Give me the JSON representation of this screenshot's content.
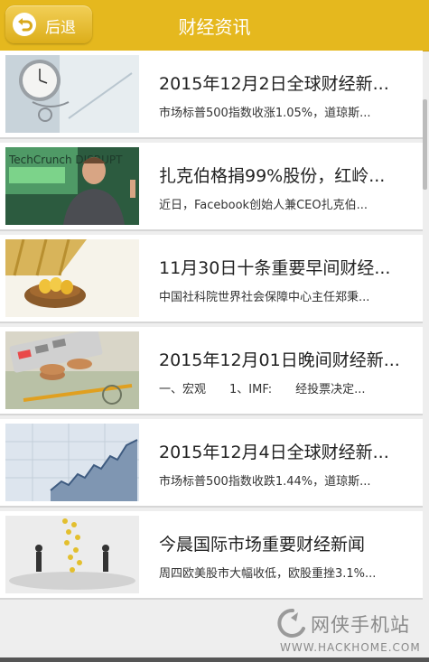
{
  "header": {
    "back_label": "后退",
    "title": "财经资讯",
    "accent_color": "#e5b81e"
  },
  "news": [
    {
      "title": "2015年12月2日全球财经新...",
      "summary": "市场标普500指数收涨1.05%，道琼斯...",
      "thumb": "pocket-watch"
    },
    {
      "title": "扎克伯格捐99%股份，红岭...",
      "summary": "近日，Facebook创始人兼CEO扎克伯...",
      "thumb": "speaker-on-stage",
      "thumb_text": "TechCrunch DISRUPT"
    },
    {
      "title": "11月30日十条重要早间财经...",
      "summary": "中国社科院世界社会保障中心主任郑秉...",
      "thumb": "nest-with-golden-eggs"
    },
    {
      "title": "2015年12月01日晚间财经新...",
      "summary": "一、宏观　　1、IMF:　　经投票决定...",
      "thumb": "coins-calculator-banknotes"
    },
    {
      "title": "2015年12月4日全球财经新...",
      "summary": "市场标普500指数收跌1.44%，道琼斯...",
      "thumb": "rising-stock-chart"
    },
    {
      "title": "今晨国际市场重要财经新闻",
      "summary": "周四欧美股市大幅收低，欧股重挫3.1%...",
      "thumb": "businessmen-and-falling-coins"
    }
  ],
  "watermark": {
    "name": "网侠手机站",
    "url": "WWW.HACKHOME.COM"
  }
}
